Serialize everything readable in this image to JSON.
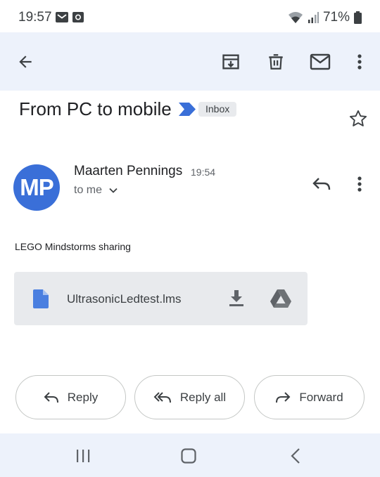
{
  "status_bar": {
    "time": "19:57",
    "battery_percent": "71%",
    "icons": [
      "mail-notification-icon",
      "media-notification-icon",
      "wifi-icon",
      "signal-icon",
      "battery-icon"
    ]
  },
  "toolbar": {
    "icons": [
      "back-arrow-icon",
      "archive-icon",
      "delete-icon",
      "mark-unread-icon",
      "more-vert-icon"
    ]
  },
  "message": {
    "subject": "From PC to mobile",
    "label": "Inbox",
    "sender": {
      "initials": "MP",
      "name": "Maarten Pennings",
      "time": "19:54",
      "recipient": "to me",
      "avatar_color": "#3a6fd8"
    },
    "body": "LEGO Mindstorms sharing",
    "attachment": {
      "filename": "UltrasonicLedtest.lms",
      "icons": [
        "file-icon",
        "download-icon",
        "google-drive-icon"
      ]
    }
  },
  "actions": {
    "reply": "Reply",
    "reply_all": "Reply all",
    "forward": "Forward"
  },
  "nav_bar": {
    "icons": [
      "recent-apps-icon",
      "home-icon",
      "back-nav-icon"
    ]
  },
  "colors": {
    "toolbar_bg": "#edf2fb",
    "accent_blue": "#3a6fd8",
    "file_blue": "#4a7fe0",
    "chip_bg": "#e8eaed"
  }
}
